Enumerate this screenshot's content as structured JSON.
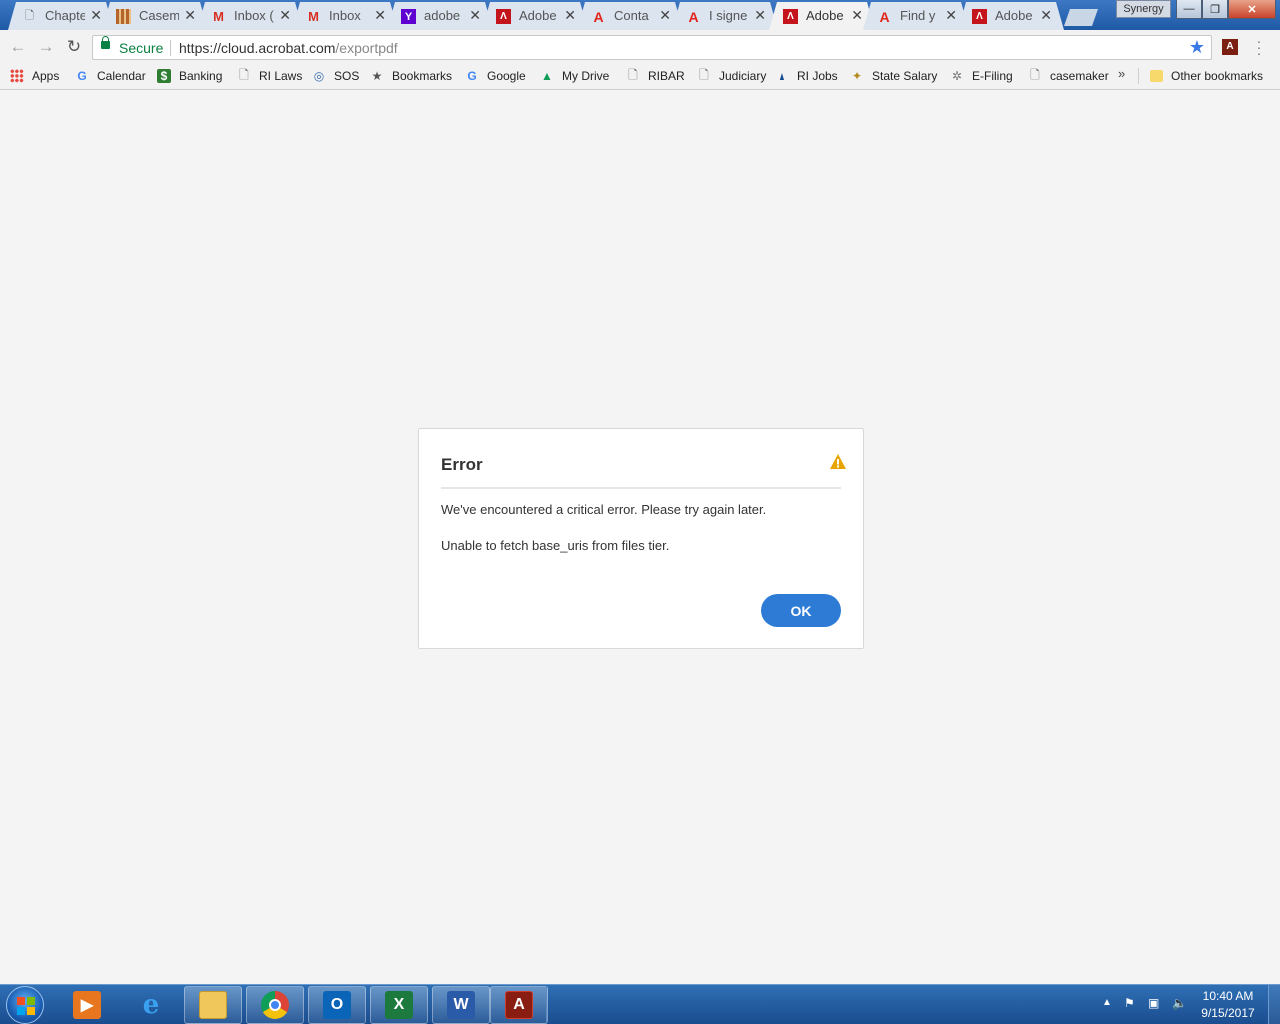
{
  "tabs": [
    {
      "title": "Chapte",
      "icon": "doc-icon"
    },
    {
      "title": "Casem",
      "icon": "casemaker-icon"
    },
    {
      "title": "Inbox (",
      "icon": "gmail-icon"
    },
    {
      "title": "Inbox",
      "icon": "gmail-icon"
    },
    {
      "title": "adobe",
      "icon": "yahoo-icon"
    },
    {
      "title": "Adobe",
      "icon": "adobe-pdf-icon"
    },
    {
      "title": "Conta",
      "icon": "adobe-icon"
    },
    {
      "title": "I signe",
      "icon": "adobe-icon"
    },
    {
      "title": "Adobe",
      "icon": "adobe-pdf-icon",
      "active": true
    },
    {
      "title": "Find y",
      "icon": "adobe-icon"
    },
    {
      "title": "Adobe",
      "icon": "adobe-pdf-icon"
    }
  ],
  "window": {
    "profile_name": "Synergy"
  },
  "omnibox": {
    "secure_label": "Secure",
    "url_domain": "https://cloud.acrobat.com",
    "url_path": "/exportpdf"
  },
  "bookmarks": [
    {
      "label": "Apps",
      "icon": "apps-grid-icon"
    },
    {
      "label": "Calendar",
      "icon": "google-icon"
    },
    {
      "label": "Banking",
      "icon": "dollar-icon"
    },
    {
      "label": "RI Laws",
      "icon": "page-icon"
    },
    {
      "label": "SOS",
      "icon": "seal-icon"
    },
    {
      "label": "Bookmarks",
      "icon": "star-icon"
    },
    {
      "label": "Google",
      "icon": "google-icon"
    },
    {
      "label": "My Drive",
      "icon": "drive-icon"
    },
    {
      "label": "RIBAR",
      "icon": "page-icon"
    },
    {
      "label": "Judiciary",
      "icon": "page-icon"
    },
    {
      "label": "RI Jobs",
      "icon": "sail-icon"
    },
    {
      "label": "State Salary",
      "icon": "badge-icon"
    },
    {
      "label": "E-Filing",
      "icon": "efiling-icon"
    },
    {
      "label": "casemaker",
      "icon": "page-icon"
    }
  ],
  "bookmarks_overflow": "»",
  "other_bookmarks": "Other bookmarks",
  "dialog": {
    "title": "Error",
    "message": "We've encountered a critical error. Please try again later.",
    "detail": "Unable to fetch base_uris from files tier.",
    "ok_label": "OK",
    "warning_color": "#e8a400",
    "button_color": "#2d7bd4"
  },
  "taskbar": {
    "apps": [
      "media-player-icon",
      "internet-explorer-icon",
      "file-explorer-icon",
      "chrome-icon",
      "outlook-icon",
      "excel-icon",
      "word-icon",
      "acrobat-icon"
    ],
    "time": "10:40 AM",
    "date": "9/15/2017"
  }
}
